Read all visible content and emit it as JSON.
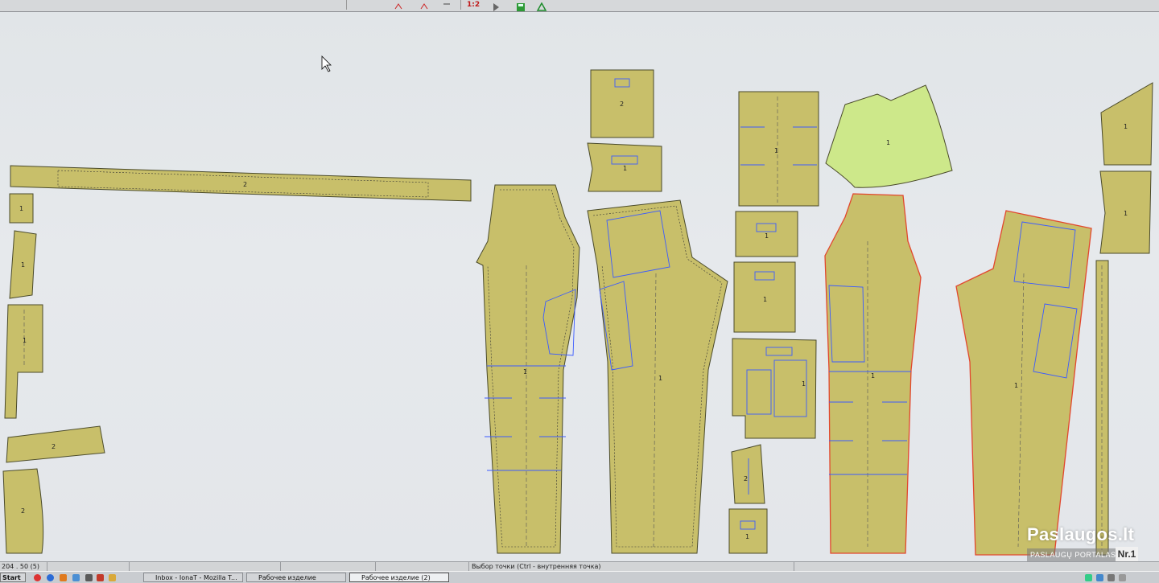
{
  "toolbar": {
    "zoom_label": "1:2"
  },
  "canvas": {
    "piece_labels": [
      "1",
      "1",
      "2",
      "2",
      "2",
      "1",
      "1",
      "1",
      "2",
      "1",
      "1",
      "1",
      "1",
      "1",
      "2",
      "1",
      "1",
      "1",
      "1",
      "1",
      "1"
    ]
  },
  "statusbar": {
    "coords": "204 . 50 (5)",
    "hint": "Выбор точки (Ctrl - внутренняя точка)"
  },
  "taskbar": {
    "start_label": "Start",
    "tasks": [
      {
        "label": "Inbox - IonaT - Mozilla T..."
      },
      {
        "label": "Рабочее изделие"
      },
      {
        "label": "Рабочее изделие (2)"
      }
    ]
  },
  "watermark": {
    "title": "Paslaugos.lt",
    "subtitle": "PASLAUGŲ PORTALAS",
    "badge": "Nr.1"
  },
  "colors": {
    "piece_fill": "#c8bf6a",
    "piece_selected_fill": "#cde88a",
    "inner_line": "#3b5bff",
    "outline_red": "#e0402a"
  }
}
